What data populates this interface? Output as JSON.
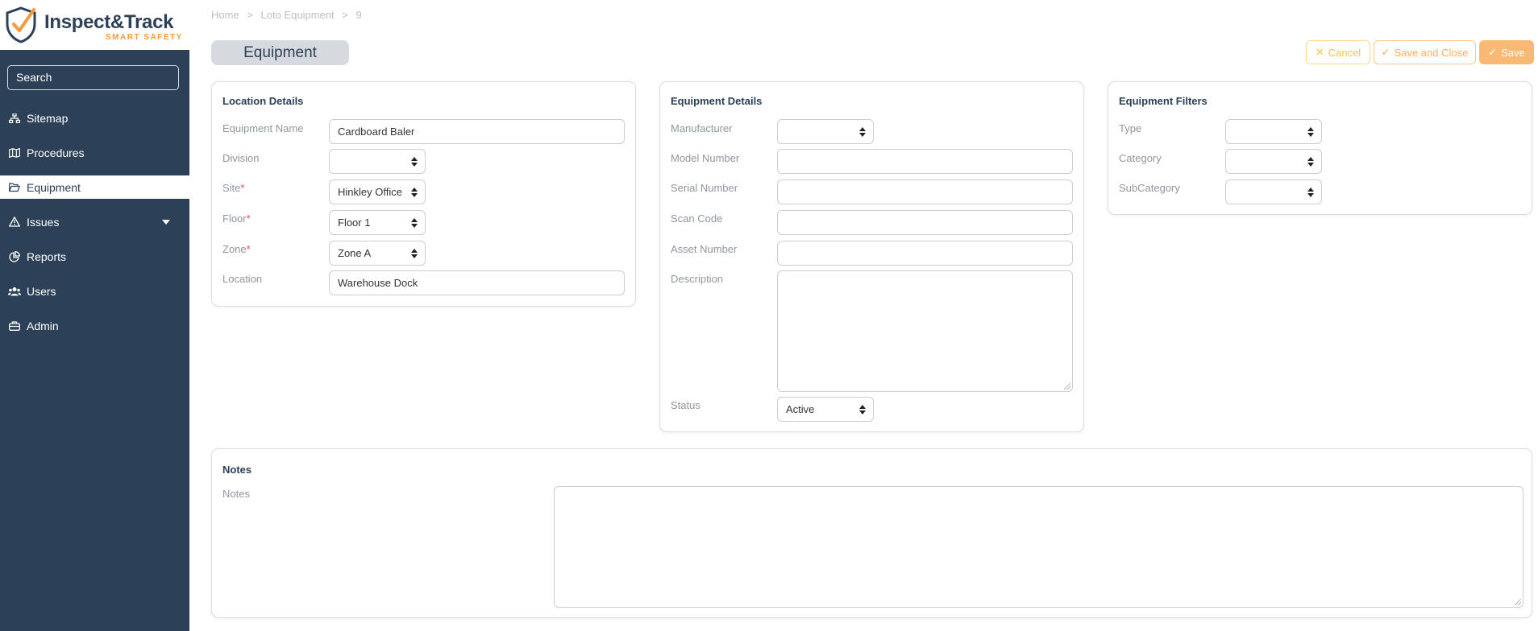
{
  "app": {
    "brand_name": "Inspect&Track",
    "brand_tagline": "SMART SAFETY"
  },
  "sidebar": {
    "search_placeholder": "Search",
    "items": [
      {
        "label": "Sitemap",
        "icon": "sitemap-icon"
      },
      {
        "label": "Procedures",
        "icon": "map-icon"
      },
      {
        "label": "Equipment",
        "icon": "folder-open-icon",
        "active": true
      },
      {
        "label": "Issues",
        "icon": "warning-triangle-icon",
        "has_dropdown": true
      },
      {
        "label": "Reports",
        "icon": "chart-pie-icon"
      },
      {
        "label": "Users",
        "icon": "users-icon"
      },
      {
        "label": "Admin",
        "icon": "toolbox-icon"
      }
    ]
  },
  "breadcrumb": [
    "Home",
    ">",
    "Loto Equipment",
    ">",
    "9"
  ],
  "page_title": "Equipment",
  "actions": {
    "cancel": "Cancel",
    "save_close": "Save and Close",
    "save": "Save"
  },
  "location_details": {
    "title": "Location Details",
    "fields": {
      "equipment_name": {
        "label": "Equipment Name",
        "value": "Cardboard Baler"
      },
      "division": {
        "label": "Division",
        "value": ""
      },
      "site": {
        "label": "Site",
        "value": "Hinkley Office",
        "required_mark": "*"
      },
      "floor": {
        "label": "Floor",
        "value": "Floor 1",
        "required_mark": "*"
      },
      "zone": {
        "label": "Zone",
        "value": "Zone A",
        "required_mark": "*"
      },
      "location": {
        "label": "Location",
        "value": "Warehouse Dock"
      }
    }
  },
  "equipment_details": {
    "title": "Equipment Details",
    "fields": {
      "manufacturer": {
        "label": "Manufacturer",
        "value": ""
      },
      "model_number": {
        "label": "Model Number",
        "value": ""
      },
      "serial_number": {
        "label": "Serial Number",
        "value": ""
      },
      "scan_code": {
        "label": "Scan Code",
        "value": ""
      },
      "asset_number": {
        "label": "Asset Number",
        "value": ""
      },
      "description": {
        "label": "Description",
        "value": ""
      },
      "status": {
        "label": "Status",
        "value": "Active"
      }
    }
  },
  "equipment_filters": {
    "title": "Equipment Filters",
    "fields": {
      "type": {
        "label": "Type",
        "value": ""
      },
      "category": {
        "label": "Category",
        "value": ""
      },
      "subcategory": {
        "label": "SubCategory",
        "value": ""
      }
    }
  },
  "notes": {
    "title": "Notes",
    "label": "Notes",
    "value": ""
  },
  "colors": {
    "sidebar_bg": "#2c4058",
    "accent": "#f59b3d",
    "required": "#d9534f"
  }
}
